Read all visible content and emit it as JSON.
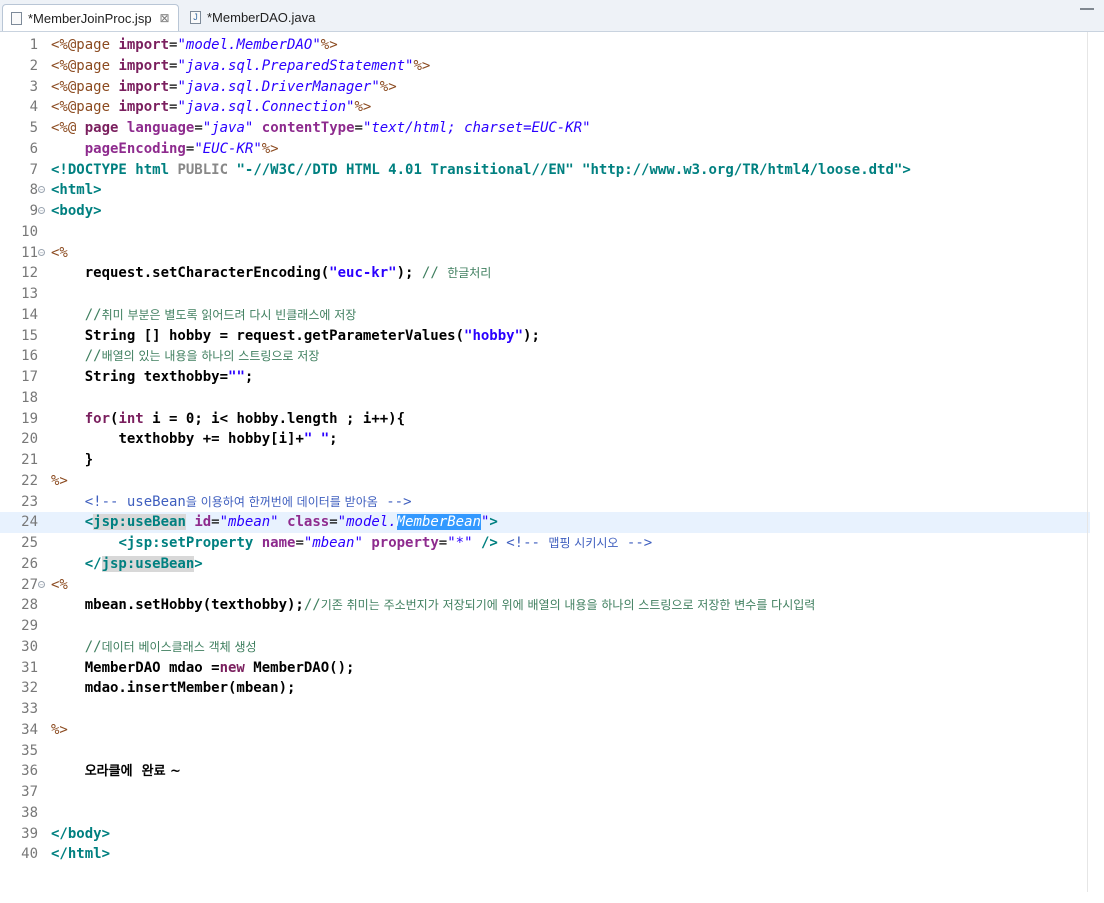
{
  "tabs": [
    {
      "label": "*MemberJoinProc.jsp",
      "close": "⊠",
      "active": true
    },
    {
      "label": "*MemberDAO.java",
      "active": false
    }
  ],
  "lines": [
    {
      "n": "1",
      "html": "<span class='tg'>&lt;%@page</span> <span class='kw'>import</span>=<span class='av'>\"model.MemberDAO\"</span><span class='tg'>%&gt;</span>"
    },
    {
      "n": "2",
      "html": "<span class='tg'>&lt;%@page</span> <span class='kw'>import</span>=<span class='av'>\"java.sql.PreparedStatement\"</span><span class='tg'>%&gt;</span>"
    },
    {
      "n": "3",
      "html": "<span class='tg'>&lt;%@page</span> <span class='kw'>import</span>=<span class='av'>\"java.sql.DriverManager\"</span><span class='tg'>%&gt;</span>"
    },
    {
      "n": "4",
      "html": "<span class='tg'>&lt;%@page</span> <span class='kw'>import</span>=<span class='av'>\"java.sql.Connection\"</span><span class='tg'>%&gt;</span>"
    },
    {
      "n": "5",
      "html": "<span class='tg'>&lt;%@</span> <span class='kw'>page</span> <span class='at'>language</span>=<span class='av'>\"java\"</span> <span class='at'>contentType</span>=<span class='av'>\"text/html; charset=EUC-KR\"</span>"
    },
    {
      "n": "6",
      "html": "    <span class='at'>pageEncoding</span>=<span class='av'>\"EUC-KR\"</span><span class='tg'>%&gt;</span>"
    },
    {
      "n": "7",
      "html": "<span class='dt'>&lt;!DOCTYPE html</span> <span class='dt' style='color:#888'>PUBLIC</span> <span class='dt'>\"-//W3C//DTD HTML 4.01 Transitional//EN\" \"http://www.w3.org/TR/html4/loose.dtd\"&gt;</span>"
    },
    {
      "n": "8",
      "fold": true,
      "html": "<span class='dt'>&lt;html&gt;</span>"
    },
    {
      "n": "9",
      "fold": true,
      "html": "<span class='dt'>&lt;body&gt;</span>"
    },
    {
      "n": "10",
      "html": ""
    },
    {
      "n": "11",
      "fold": true,
      "html": "<span class='tg'>&lt;%</span>"
    },
    {
      "n": "12",
      "html": "    <span class='pl'>request.setCharacterEncoding(</span><span class='st'>\"euc-kr\"</span><span class='pl'>);</span> <span class='cm'>// <span class='ko'>한글처리</span></span>"
    },
    {
      "n": "13",
      "html": ""
    },
    {
      "n": "14",
      "html": "    <span class='cm'>//<span class='ko'>취미 부분은 별도록 읽어드려 다시 빈클래스에 저장</span></span>"
    },
    {
      "n": "15",
      "html": "    <span class='pl'>String [] hobby = request.getParameterValues(</span><span class='st'>\"hobby\"</span><span class='pl'>);</span>"
    },
    {
      "n": "16",
      "html": "    <span class='cm'>//<span class='ko'>배열의 있는 내용을 하나의 스트링으로 저장</span></span>"
    },
    {
      "n": "17",
      "html": "    <span class='pl'>String texthobby=</span><span class='st'>\"\"</span><span class='pl'>;</span>"
    },
    {
      "n": "18",
      "html": ""
    },
    {
      "n": "19",
      "html": "    <span class='kw'>for</span><span class='pl'>(</span><span class='kw'>int</span><span class='pl'> i = 0; i&lt; hobby.length ; i++){</span>"
    },
    {
      "n": "20",
      "html": "        <span class='pl'>texthobby += hobby[i]+</span><span class='st'>\" \"</span><span class='pl'>;</span>"
    },
    {
      "n": "21",
      "html": "    <span class='pl'>}</span>"
    },
    {
      "n": "22",
      "html": "<span class='tg'>%&gt;</span>"
    },
    {
      "n": "23",
      "html": "    <span class='hc'>&lt;!-- useBean<span class='ko'>을 이용하여 한꺼번에 데이터를 받아옴</span> --&gt;</span>"
    },
    {
      "n": "24",
      "current": true,
      "html": "    <span class='dt'>&lt;<span class='tagsel'>jsp:useBean</span></span> <span class='at'>id</span>=<span class='av'>\"mbean\"</span> <span class='at'>class</span>=<span class='av'>\"model.<span class='sel'>MemberBean</span>\"</span><span class='dt'>&gt;</span>"
    },
    {
      "n": "25",
      "html": "        <span class='dt'>&lt;jsp:setProperty</span> <span class='at'>name</span>=<span class='av'>\"mbean\"</span> <span class='at'>property</span>=<span class='av'>\"*\"</span> <span class='dt'>/&gt;</span> <span class='hc'>&lt;!-- <span class='ko'>맵핑 시키시오</span> --&gt;</span>"
    },
    {
      "n": "26",
      "html": "    <span class='dt'>&lt;/<span class='tagsel'>jsp:useBean</span>&gt;</span>"
    },
    {
      "n": "27",
      "fold": true,
      "html": "<span class='tg'>&lt;%</span>"
    },
    {
      "n": "28",
      "html": "    <span class='pl'>mbean.setHobby(texthobby);</span><span class='cm'>//<span class='ko'>기존 취미는 주소번지가 저장되기에 위에 배열의 내용을 하나의 스트링으로 저장한 변수를 다시입력</span></span>"
    },
    {
      "n": "29",
      "html": ""
    },
    {
      "n": "30",
      "html": "    <span class='cm'>//<span class='ko'>데이터 베이스클래스 객체 생성</span></span>"
    },
    {
      "n": "31",
      "html": "    <span class='pl'>MemberDAO mdao =</span><span class='kw'>new</span><span class='pl'> MemberDAO();</span>"
    },
    {
      "n": "32",
      "html": "    <span class='pl'>mdao.insertMember(mbean);</span>"
    },
    {
      "n": "33",
      "html": ""
    },
    {
      "n": "34",
      "html": "<span class='tg'>%&gt;</span>"
    },
    {
      "n": "35",
      "html": ""
    },
    {
      "n": "36",
      "html": "    <span class='pl ko' style='font-size:13px'>오라클에  완료 ~</span>"
    },
    {
      "n": "37",
      "html": ""
    },
    {
      "n": "38",
      "html": ""
    },
    {
      "n": "39",
      "html": "<span class='dt'>&lt;/body&gt;</span>"
    },
    {
      "n": "40",
      "html": "<span class='dt'>&lt;/html&gt;</span>"
    }
  ],
  "colors": {
    "keyword": "#7a1f5e",
    "string": "#2a00ff",
    "comment": "#3f7f5f",
    "selection": "#3399ff",
    "current_line": "#e8f2fe"
  },
  "icons": {
    "jsp_tab": "file-icon",
    "java_tab": "java-file-icon"
  }
}
